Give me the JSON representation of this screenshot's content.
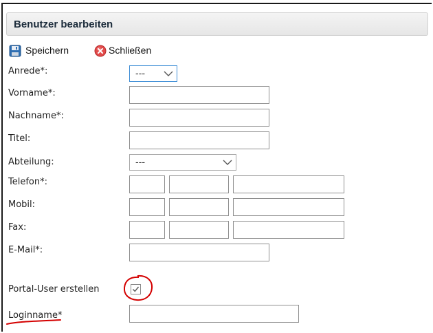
{
  "form": {
    "title": "Benutzer bearbeiten",
    "toolbar": {
      "save_label": "Speichern",
      "close_label": "Schließen"
    },
    "fields": {
      "anrede": {
        "label": "Anrede*:",
        "selected": "---"
      },
      "vorname": {
        "label": "Vorname*:",
        "value": ""
      },
      "nachname": {
        "label": "Nachname*:",
        "value": ""
      },
      "titel": {
        "label": "Titel:",
        "value": ""
      },
      "abteilung": {
        "label": "Abteilung:",
        "selected": "---"
      },
      "telefon": {
        "label": "Telefon*:",
        "values": [
          "",
          "",
          ""
        ]
      },
      "mobil": {
        "label": "Mobil:",
        "values": [
          "",
          "",
          ""
        ]
      },
      "fax": {
        "label": "Fax:",
        "values": [
          "",
          "",
          ""
        ]
      },
      "email": {
        "label": "E-Mail*:",
        "value": ""
      },
      "portal_user": {
        "label": "Portal-User erstellen",
        "checked": true
      },
      "loginname": {
        "label": "Loginname*",
        "value": ""
      }
    }
  },
  "colors": {
    "annotation_red": "#d40000",
    "select_focus_blue": "#3f8ed6"
  },
  "icons": {
    "save": "floppy-disk-icon",
    "close": "red-x-circle-icon",
    "dropdown": "chevron-down-icon"
  }
}
